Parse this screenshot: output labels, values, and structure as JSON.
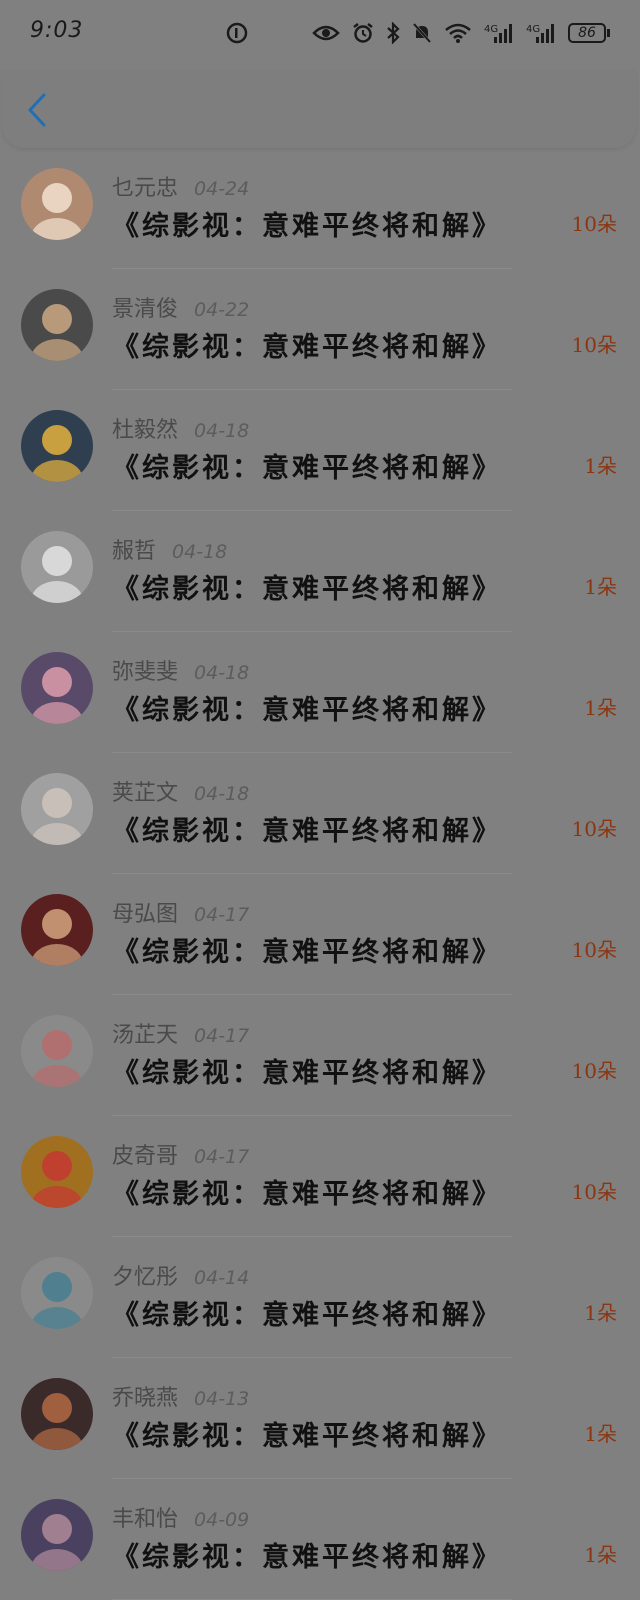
{
  "status_bar": {
    "time": "9:03",
    "battery": "86"
  },
  "colors": {
    "background": "#808080",
    "accent_back": "#1f6fb5",
    "count": "#8b3610"
  },
  "icons": [
    "eye-icon",
    "alarm-icon",
    "bluetooth-icon",
    "mute-icon",
    "wifi-icon",
    "signal-4g-icon",
    "battery-icon",
    "back-arrow-icon"
  ],
  "list": [
    {
      "name": "乜元忠",
      "date": "04-24",
      "title": "《综影视：意难平终将和解》",
      "count": "10朵",
      "avatar": {
        "bg": "#b08a70",
        "fg": "#e8d4c0"
      }
    },
    {
      "name": "景清俊",
      "date": "04-22",
      "title": "《综影视：意难平终将和解》",
      "count": "10朵",
      "avatar": {
        "bg": "#4a4a4a",
        "fg": "#b89a7a"
      }
    },
    {
      "name": "杜毅然",
      "date": "04-18",
      "title": "《综影视：意难平终将和解》",
      "count": "1朵",
      "avatar": {
        "bg": "#2f3f4f",
        "fg": "#c9a040"
      }
    },
    {
      "name": "赧哲",
      "date": "04-18",
      "title": "《综影视：意难平终将和解》",
      "count": "1朵",
      "avatar": {
        "bg": "#9a9a9a",
        "fg": "#d8d8d8"
      }
    },
    {
      "name": "弥斐斐",
      "date": "04-18",
      "title": "《综影视：意难平终将和解》",
      "count": "1朵",
      "avatar": {
        "bg": "#5a4a6a",
        "fg": "#c890a0"
      }
    },
    {
      "name": "荚芷文",
      "date": "04-18",
      "title": "《综影视：意难平终将和解》",
      "count": "10朵",
      "avatar": {
        "bg": "#a0a0a0",
        "fg": "#c8c0b8"
      }
    },
    {
      "name": "母弘图",
      "date": "04-17",
      "title": "《综影视：意难平终将和解》",
      "count": "10朵",
      "avatar": {
        "bg": "#5a2020",
        "fg": "#c09070"
      }
    },
    {
      "name": "汤芷天",
      "date": "04-17",
      "title": "《综影视：意难平终将和解》",
      "count": "10朵",
      "avatar": {
        "bg": "#8a8a8a",
        "fg": "#b07070"
      }
    },
    {
      "name": "皮奇哥",
      "date": "04-17",
      "title": "《综影视：意难平终将和解》",
      "count": "10朵",
      "avatar": {
        "bg": "#a07020",
        "fg": "#c04030"
      }
    },
    {
      "name": "夕忆彤",
      "date": "04-14",
      "title": "《综影视：意难平终将和解》",
      "count": "1朵",
      "avatar": {
        "bg": "#8a8a8a",
        "fg": "#508090"
      }
    },
    {
      "name": "乔晓燕",
      "date": "04-13",
      "title": "《综影视：意难平终将和解》",
      "count": "1朵",
      "avatar": {
        "bg": "#3a2a2a",
        "fg": "#a06040"
      }
    },
    {
      "name": "丰和怡",
      "date": "04-09",
      "title": "《综影视：意难平终将和解》",
      "count": "1朵",
      "avatar": {
        "bg": "#4a4060",
        "fg": "#a08090"
      }
    }
  ]
}
